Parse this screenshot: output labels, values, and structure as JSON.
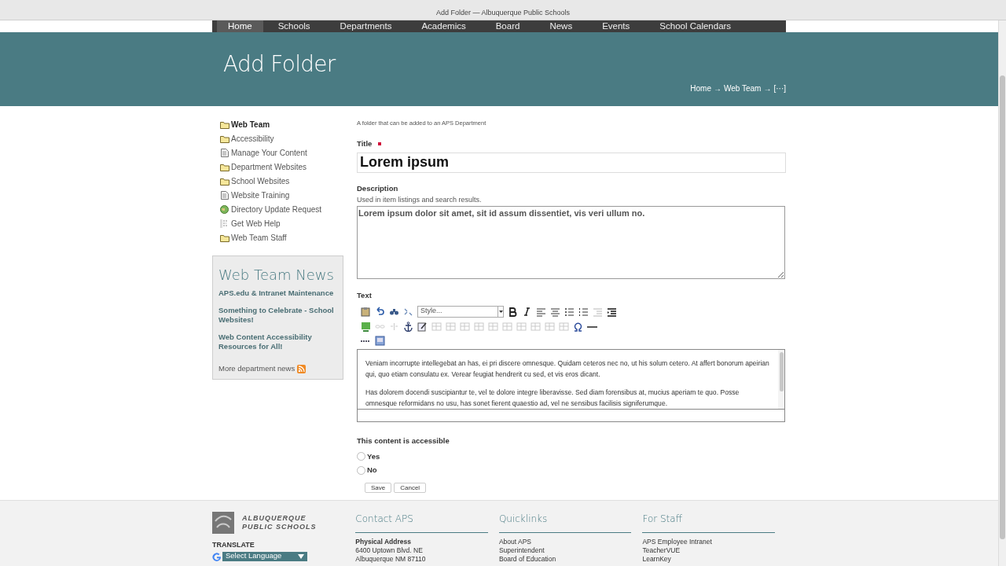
{
  "window": {
    "title": "Add Folder — Albuquerque Public Schools"
  },
  "nav": [
    {
      "label": "Home",
      "selected": true
    },
    {
      "label": "Schools",
      "selected": false
    },
    {
      "label": "Departments",
      "selected": false
    },
    {
      "label": "Academics",
      "selected": false
    },
    {
      "label": "Board",
      "selected": false
    },
    {
      "label": "News",
      "selected": false
    },
    {
      "label": "Events",
      "selected": false
    },
    {
      "label": "School Calendars",
      "selected": false
    }
  ],
  "header": {
    "title": "Add Folder",
    "breadcrumb": [
      "Home",
      "Web Team",
      "[···]"
    ],
    "separator": "→"
  },
  "sidebar": {
    "items": [
      {
        "label": "Web Team",
        "kind": "folder",
        "selected": true
      },
      {
        "label": "Accessibility",
        "kind": "folder",
        "selected": false
      },
      {
        "label": "Manage Your Content",
        "kind": "page",
        "selected": false
      },
      {
        "label": "Department Websites",
        "kind": "folder",
        "selected": false
      },
      {
        "label": "School Websites",
        "kind": "folder",
        "selected": false
      },
      {
        "label": "Website Training",
        "kind": "page",
        "selected": false
      },
      {
        "label": "Directory Update Request",
        "kind": "globe",
        "selected": false
      },
      {
        "label": "Get Web Help",
        "kind": "form",
        "selected": false
      },
      {
        "label": "Web Team Staff",
        "kind": "folder",
        "selected": false
      }
    ],
    "news": {
      "title": "Web Team News",
      "items": [
        "APS.edu & Intranet Maintenance",
        "Something to Celebrate - School Websites!",
        "Web Content Accessibility Resources for All!"
      ],
      "more": "More department news"
    }
  },
  "form": {
    "intro": "A folder that can be added to an APS Department",
    "title_field": {
      "label": "Title",
      "required": true,
      "value": "Lorem ipsum"
    },
    "description": {
      "label": "Description",
      "help": "Used in item listings and search results.",
      "value": "Lorem ipsum dolor sit amet, sit id assum dissentiet, vis veri ullum no."
    },
    "text": {
      "label": "Text",
      "style_select": "Style...",
      "paragraphs": [
        "Veniam incorrupte intellegebat an has, ei pri discere omnesque. Quidam ceteros nec no, ut his solum cetero. At affert bonorum apeirian qui, quo etiam consulatu ex. Verear feugiat hendrerit cu sed, et vis eros dicant.",
        "Has dolorem docendi suscipiantur te, vel te dolore integre liberavisse. Sed diam forensibus at, mucius aperiam te quo. Posse omnesque reformidans no usu, has sonet fierent quaestio ad, vel ne sensibus facilisis signiferumque."
      ]
    },
    "accessible": {
      "label": "This content is accessible",
      "options": [
        {
          "label": "Yes",
          "checked": false
        },
        {
          "label": "No",
          "checked": false
        }
      ]
    },
    "buttons": [
      "Save",
      "Cancel"
    ]
  },
  "footer": {
    "logo": [
      "ALBUQUERQUE",
      "PUBLIC SCHOOLS"
    ],
    "translate": "TRANSLATE",
    "language": "Select Language",
    "columns": [
      {
        "title": "Contact APS",
        "heading": "Physical Address",
        "lines": [
          "6400 Uptown Blvd. NE",
          "Albuquerque NM 87110"
        ]
      },
      {
        "title": "Quicklinks",
        "lines": [
          "About APS",
          "Superintendent",
          "Board of Education"
        ]
      },
      {
        "title": "For Staff",
        "lines": [
          "APS Employee Intranet",
          "TeacherVUE",
          "LearnKey"
        ]
      }
    ]
  }
}
